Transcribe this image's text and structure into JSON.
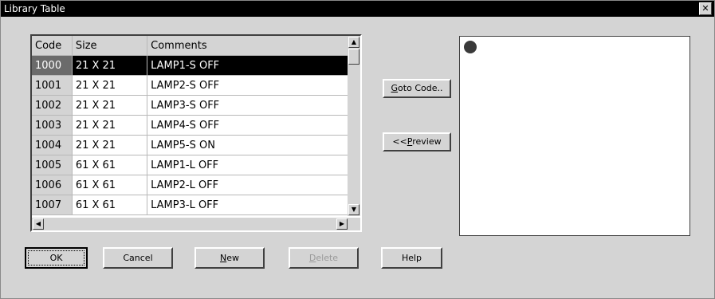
{
  "window": {
    "title": "Library Table",
    "close_glyph": "✕"
  },
  "table": {
    "columns": [
      "Code",
      "Size",
      "Comments"
    ],
    "rows": [
      {
        "code": "1000",
        "size": "21 X 21",
        "comment": "LAMP1-S OFF"
      },
      {
        "code": "1001",
        "size": "21 X 21",
        "comment": "LAMP2-S OFF"
      },
      {
        "code": "1002",
        "size": "21 X 21",
        "comment": "LAMP3-S OFF"
      },
      {
        "code": "1003",
        "size": "21 X 21",
        "comment": "LAMP4-S OFF"
      },
      {
        "code": "1004",
        "size": "21 X 21",
        "comment": "LAMP5-S ON"
      },
      {
        "code": "1005",
        "size": "61 X 61",
        "comment": "LAMP1-L OFF"
      },
      {
        "code": "1006",
        "size": "61 X 61",
        "comment": "LAMP2-L OFF"
      },
      {
        "code": "1007",
        "size": "61 X 61",
        "comment": "LAMP3-L OFF"
      }
    ],
    "selected_row": 0
  },
  "side_buttons": {
    "goto_label_ul": "G",
    "goto_label_rest": "oto Code..",
    "preview_label_pre": "<<",
    "preview_label_ul": "P",
    "preview_label_rest": "review"
  },
  "bottom_buttons": {
    "ok": "OK",
    "cancel": "Cancel",
    "new_ul": "N",
    "new_rest": "ew",
    "delete_ul": "D",
    "delete_rest": "elete",
    "help": "Help"
  },
  "icons": {
    "scroll_up": "▲",
    "scroll_down": "▼",
    "scroll_left": "◀",
    "scroll_right": "▶"
  },
  "preview": {
    "shape": "lamp-circle",
    "color": "#3a3a3a"
  }
}
